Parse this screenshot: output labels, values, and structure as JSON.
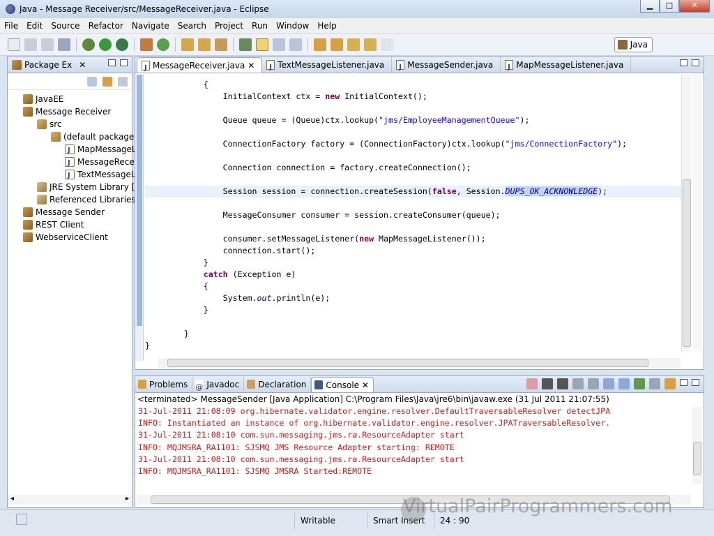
{
  "window": {
    "title": "Java - Message Receiver/src/MessageReceiver.java - Eclipse",
    "min": "▁",
    "max": "□",
    "close": "✕"
  },
  "menu": [
    "File",
    "Edit",
    "Source",
    "Refactor",
    "Navigate",
    "Search",
    "Project",
    "Run",
    "Window",
    "Help"
  ],
  "perspective": {
    "label": "Java"
  },
  "package_explorer": {
    "title": "Package Ex",
    "items": [
      {
        "label": "JavaEE",
        "icon": "project-icon",
        "indent": 0
      },
      {
        "label": "Message Receiver",
        "icon": "project-icon",
        "indent": 0
      },
      {
        "label": "src",
        "icon": "source-folder-icon",
        "indent": 1
      },
      {
        "label": "(default package)",
        "icon": "package-icon",
        "indent": 2
      },
      {
        "label": "MapMessageL",
        "icon": "java-file-icon",
        "indent": 3
      },
      {
        "label": "MessageRecei",
        "icon": "java-file-icon",
        "indent": 3
      },
      {
        "label": "TextMessageL",
        "icon": "java-file-icon",
        "indent": 3
      },
      {
        "label": "JRE System Library [Ja",
        "icon": "library-icon",
        "indent": 1
      },
      {
        "label": "Referenced Libraries",
        "icon": "library-icon",
        "indent": 1
      },
      {
        "label": "Message Sender",
        "icon": "project-icon",
        "indent": 0
      },
      {
        "label": "REST Client",
        "icon": "project-icon",
        "indent": 0
      },
      {
        "label": "WebserviceClient",
        "icon": "project-icon",
        "indent": 0
      }
    ]
  },
  "editor": {
    "tabs": [
      {
        "label": "MessageReceiver.java",
        "active": true
      },
      {
        "label": "TextMessageListener.java",
        "active": false
      },
      {
        "label": "MessageSender.java",
        "active": false
      },
      {
        "label": "MapMessageListener.java",
        "active": false
      }
    ]
  },
  "console": {
    "tabs": [
      "Problems",
      "Javadoc",
      "Declaration",
      "Console"
    ],
    "active_tab": "Console",
    "description": "<terminated> MessageSender [Java Application] C:\\Program Files\\Java\\jre6\\bin\\javaw.exe (31 Jul 2011 21:07:55)",
    "lines": [
      "31-Jul-2011 21:08:09 org.hibernate.validator.engine.resolver.DefaultTraversableResolver detectJPA",
      "INFO: Instantiated an instance of org.hibernate.validator.engine.resolver.JPATraversableResolver.",
      "31-Jul-2011 21:08:10 com.sun.messaging.jms.ra.ResourceAdapter start",
      "INFO: MQJMSRA_RA1101: SJSMQ JMS Resource Adapter starting: REMOTE",
      "31-Jul-2011 21:08:10 com.sun.messaging.jms.ra.ResourceAdapter start",
      "INFO: MQJMSRA_RA1101: SJSMQ JMSRA Started:REMOTE"
    ]
  },
  "status": {
    "writable": "Writable",
    "insert_mode": "Smart Insert",
    "position": "24 : 90"
  },
  "watermark": "VirtualPairProgrammers.com"
}
